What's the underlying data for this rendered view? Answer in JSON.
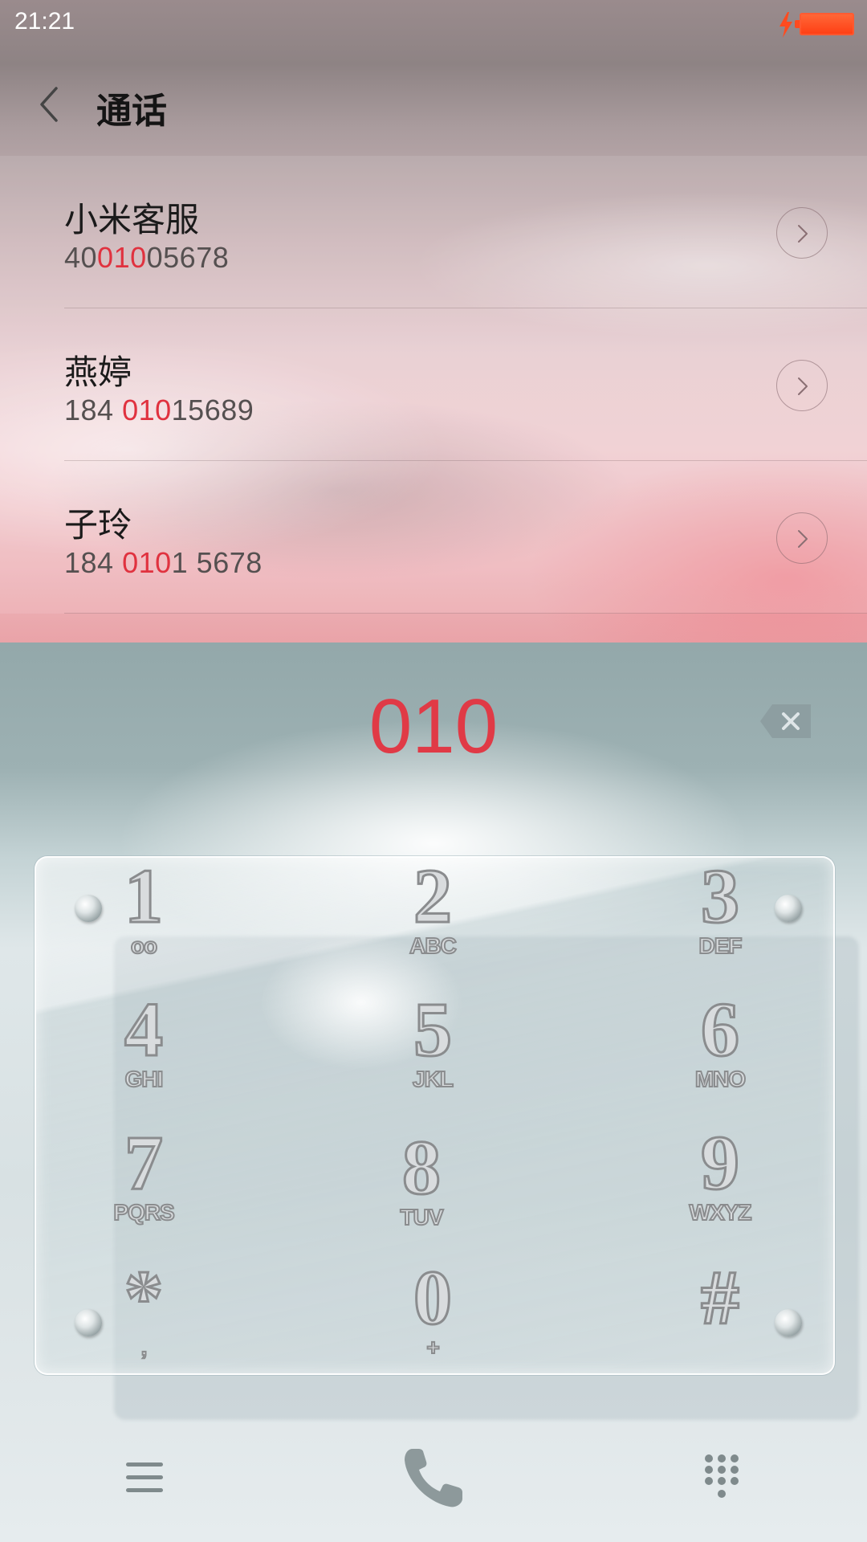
{
  "status_bar": {
    "time": "21:21"
  },
  "header": {
    "title": "通话"
  },
  "contacts": [
    {
      "name": "小米客服",
      "number_pre": "40",
      "number_match": "010",
      "number_post": "05678"
    },
    {
      "name": "燕婷",
      "number_pre": "184 ",
      "number_match": "010",
      "number_post": "15689"
    },
    {
      "name": "子玲",
      "number_pre": "184 ",
      "number_match": "010",
      "number_post": "1 5678"
    }
  ],
  "dialer": {
    "dialed_number": "010",
    "keys": [
      {
        "digit": "1",
        "letters": "oo"
      },
      {
        "digit": "2",
        "letters": "ABC"
      },
      {
        "digit": "3",
        "letters": "DEF"
      },
      {
        "digit": "4",
        "letters": "GHI"
      },
      {
        "digit": "5",
        "letters": "JKL"
      },
      {
        "digit": "6",
        "letters": "MNO"
      },
      {
        "digit": "7",
        "letters": "PQRS"
      },
      {
        "digit": "8",
        "letters": "TUV"
      },
      {
        "digit": "9",
        "letters": "WXYZ"
      },
      {
        "digit": "*",
        "letters": ","
      },
      {
        "digit": "0",
        "letters": "+"
      },
      {
        "digit": "#",
        "letters": ""
      }
    ]
  },
  "icons": {
    "back": "chevron-left-icon",
    "detail": "chevron-right-circle-icon",
    "backspace": "backspace-icon",
    "menu": "menu-icon",
    "call": "phone-icon",
    "keypad": "dialpad-icon"
  },
  "colors": {
    "highlight": "#e03a46",
    "battery": "#ff4b1f"
  }
}
